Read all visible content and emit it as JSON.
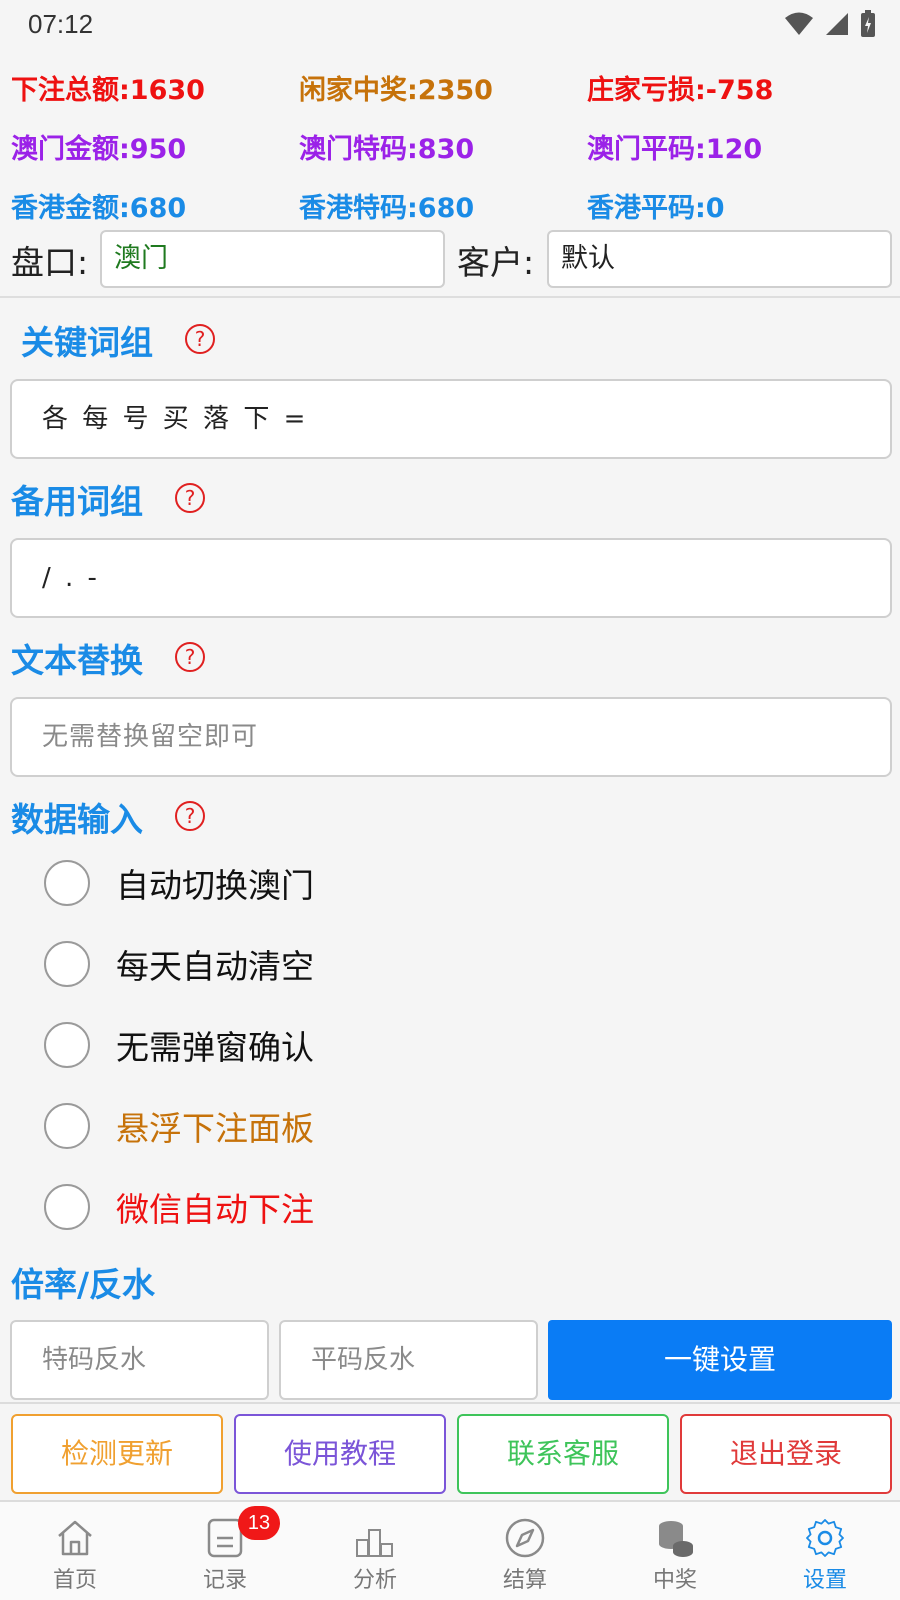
{
  "status_bar": {
    "time": "07:12"
  },
  "stats": [
    {
      "label": "下注总额:1630",
      "color": "#ee1111"
    },
    {
      "label": "闲家中奖:2350",
      "color": "#c6720a"
    },
    {
      "label": "庄家亏损:-758",
      "color": "#ee1111"
    },
    {
      "label": "澳门金额:950",
      "color": "#9b22e8"
    },
    {
      "label": "澳门特码:830",
      "color": "#9b22e8"
    },
    {
      "label": "澳门平码:120",
      "color": "#9b22e8"
    },
    {
      "label": "香港金额:680",
      "color": "#1a8be6"
    },
    {
      "label": "香港特码:680",
      "color": "#1a8be6"
    },
    {
      "label": "香港平码:0",
      "color": "#1a8be6"
    }
  ],
  "market": {
    "label": "盘口:",
    "value": "澳门"
  },
  "customer": {
    "label": "客户:",
    "value": "默认"
  },
  "sections": {
    "keywords": {
      "title": "关键词组",
      "value": "各 每 号 买 落 下 ="
    },
    "backup": {
      "title": "备用词组",
      "value": "/ . -"
    },
    "replace": {
      "title": "文本替换",
      "placeholder": "无需替换留空即可"
    },
    "data_input": {
      "title": "数据输入",
      "options": [
        {
          "label": "自动切换澳门",
          "checked": false,
          "color": "#111111"
        },
        {
          "label": "每天自动清空",
          "checked": false,
          "color": "#111111"
        },
        {
          "label": "无需弹窗确认",
          "checked": false,
          "color": "#111111"
        },
        {
          "label": "悬浮下注面板",
          "checked": false,
          "color": "#c6720a"
        },
        {
          "label": "微信自动下注",
          "checked": false,
          "color": "#ee1111"
        }
      ]
    },
    "rate": {
      "title": "倍率/反水",
      "special_placeholder": "特码反水",
      "normal_placeholder": "平码反水",
      "button": "一键设置"
    }
  },
  "help_symbol": "?",
  "actions": [
    {
      "label": "检测更新",
      "color": "#f0a030"
    },
    {
      "label": "使用教程",
      "color": "#7b55d8"
    },
    {
      "label": "联系客服",
      "color": "#3ec45a"
    },
    {
      "label": "退出登录",
      "color": "#e03a3a"
    }
  ],
  "tabs": [
    {
      "label": "首页",
      "icon": "home-icon"
    },
    {
      "label": "记录",
      "icon": "record-icon",
      "badge": "13"
    },
    {
      "label": "分析",
      "icon": "analysis-icon"
    },
    {
      "label": "结算",
      "icon": "compass-icon"
    },
    {
      "label": "中奖",
      "icon": "coins-icon"
    },
    {
      "label": "设置",
      "icon": "gear-icon",
      "active": true
    }
  ]
}
